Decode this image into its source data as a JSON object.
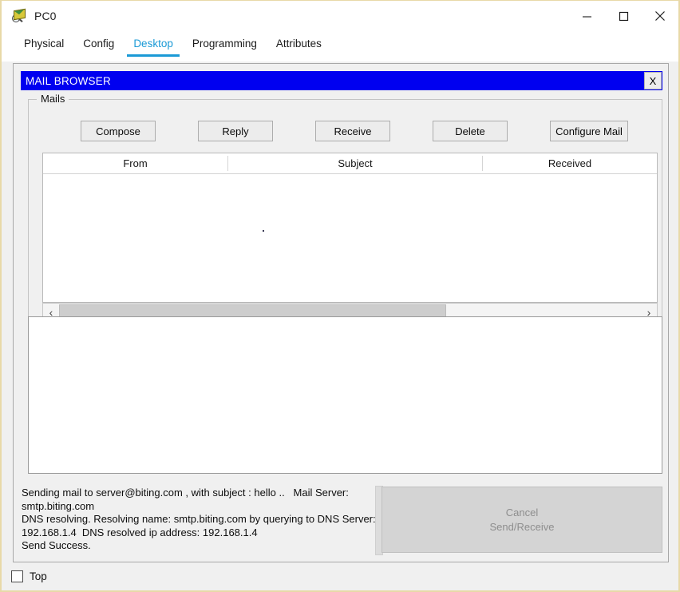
{
  "window": {
    "title": "PC0",
    "icon": "pc-mail-magnifier-icon",
    "border_color": "#e8d9a8",
    "controls": {
      "minimize": "minimize-icon",
      "maximize": "maximize-icon",
      "close": "close-icon"
    }
  },
  "tabs": [
    {
      "label": "Physical",
      "active": false
    },
    {
      "label": "Config",
      "active": false
    },
    {
      "label": "Desktop",
      "active": true
    },
    {
      "label": "Programming",
      "active": false
    },
    {
      "label": "Attributes",
      "active": false
    }
  ],
  "accent_color": "#1b9ad6",
  "mail_browser": {
    "title": "MAIL BROWSER",
    "title_bar_color": "#0000f0",
    "close_label": "X",
    "group_legend": "Mails",
    "toolbar": [
      {
        "label": "Compose",
        "name": "compose-button"
      },
      {
        "label": "Reply",
        "name": "reply-button"
      },
      {
        "label": "Receive",
        "name": "receive-button"
      },
      {
        "label": "Delete",
        "name": "delete-button"
      },
      {
        "label": "Configure Mail",
        "name": "configure-mail-button"
      }
    ],
    "table": {
      "columns": [
        "From",
        "Subject",
        "Received"
      ],
      "rows": []
    },
    "scrollbar": {
      "left_arrow": "‹",
      "right_arrow": "›"
    },
    "message_body": "",
    "log": "Sending mail to server@biting.com , with subject : hello ..   Mail Server: smtp.biting.com\nDNS resolving. Resolving name: smtp.biting.com by querying to DNS Server: 192.168.1.4  DNS resolved ip address: 192.168.1.4\nSend Success.",
    "cancel_button": {
      "line1": "Cancel",
      "line2": "Send/Receive",
      "enabled": false
    }
  },
  "footer": {
    "top_checkbox_label": "Top",
    "top_checkbox_checked": false
  }
}
